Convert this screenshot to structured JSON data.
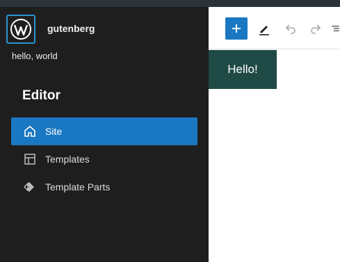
{
  "site": {
    "name": "gutenberg",
    "tagline": "hello, world"
  },
  "sidebar": {
    "title": "Editor",
    "items": [
      {
        "label": "Site",
        "icon": "home-icon",
        "active": true
      },
      {
        "label": "Templates",
        "icon": "layout-icon",
        "active": false
      },
      {
        "label": "Template Parts",
        "icon": "symbol-icon",
        "active": false
      }
    ]
  },
  "toolbar": {
    "tools": [
      "add-block-icon",
      "edit-pen-icon",
      "undo-icon",
      "redo-icon",
      "list-view-icon"
    ]
  },
  "canvas": {
    "block_text": "Hello!"
  },
  "colors": {
    "accent": "#1a78c2",
    "sidebar_bg": "#1e1e1e",
    "block_bg": "#1f4a46"
  }
}
